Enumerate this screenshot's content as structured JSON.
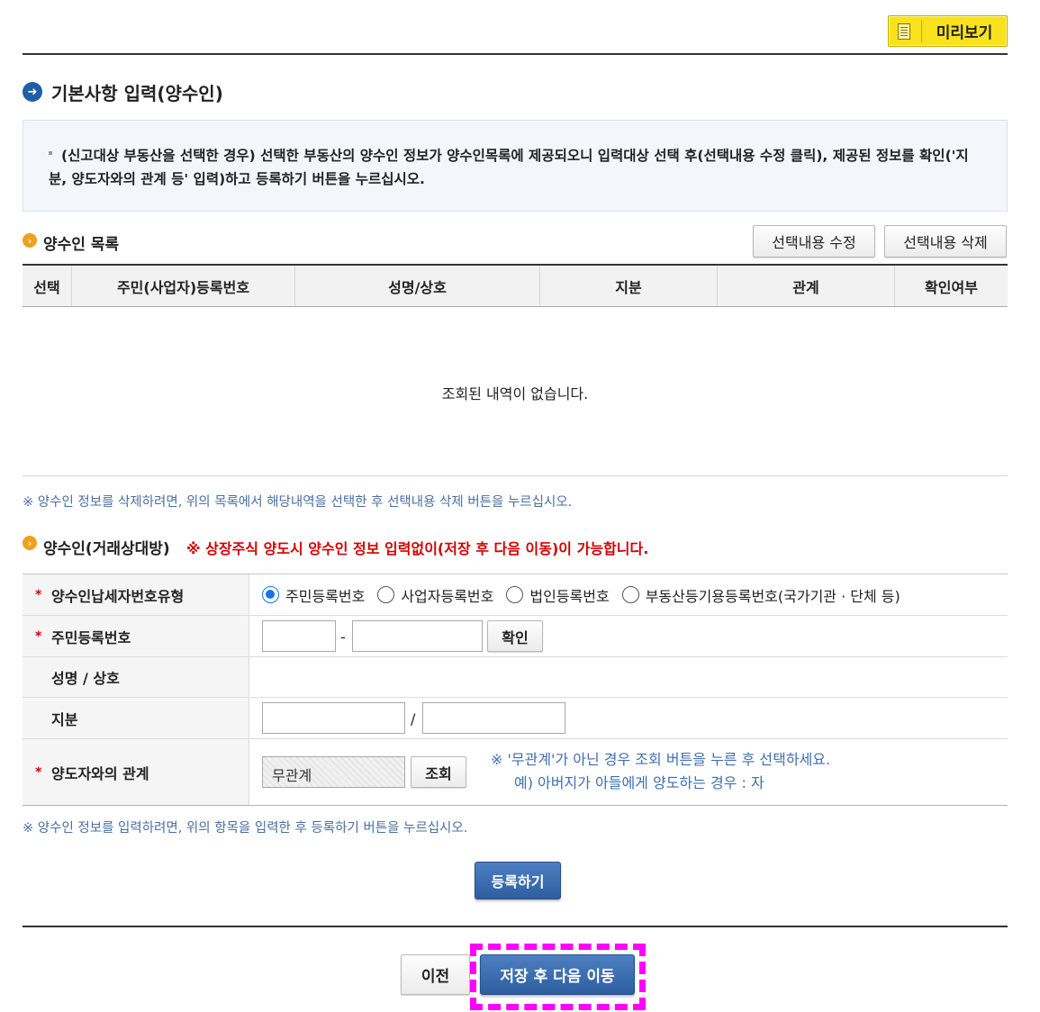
{
  "header": {
    "preview_label": "미리보기",
    "section_title": "기본사항 입력(양수인)"
  },
  "notice": {
    "text": "(신고대상 부동산을 선택한 경우) 선택한 부동산의 양수인 정보가 양수인목록에 제공되오니 입력대상 선택 후(선택내용 수정 클릭), 제공된 정보를 확인('지분, 양도자와의 관계 등' 입력)하고 등록하기 버튼을 누르십시오."
  },
  "list": {
    "title": "양수인 목록",
    "edit_button": "선택내용 수정",
    "delete_button": "선택내용 삭제",
    "columns": [
      "선택",
      "주민(사업자)등록번호",
      "성명/상호",
      "지분",
      "관계",
      "확인여부"
    ],
    "empty_message": "조회된 내역이 없습니다.",
    "delete_note": "※ 양수인 정보를 삭제하려면, 위의 목록에서 해당내역을 선택한 후 선택내용 삭제 버튼을 누르십시오."
  },
  "form": {
    "title": "양수인(거래상대방)",
    "red_note": "※ 상장주식 양도시 양수인 정보 입력없이(저장 후 다음 이동)이 가능합니다.",
    "rows": {
      "type_label": "양수인납세자번호유형",
      "id_label": "주민등록번호",
      "name_label": "성명 / 상호",
      "share_label": "지분",
      "relation_label": "양도자와의 관계"
    },
    "type_options": [
      "주민등록번호",
      "사업자등록번호",
      "법인등록번호",
      "부동산등기용등록번호(국가기관 · 단체 등)"
    ],
    "id_separator": "-",
    "confirm_button": "확인",
    "share_separator": "/",
    "relation_value": "무관계",
    "lookup_button": "조회",
    "relation_note_1": "※ '무관계'가 아닌 경우 조회 버튼을 누른 후 선택하세요.",
    "relation_note_2": "예) 아버지가 아들에게 양도하는 경우 : 자",
    "input_note": "※ 양수인 정보를 입력하려면, 위의 항목을 입력한 후 등록하기 버튼을 누르십시오.",
    "register_button": "등록하기"
  },
  "footer": {
    "prev_button": "이전",
    "next_button": "저장 후 다음 이동"
  }
}
